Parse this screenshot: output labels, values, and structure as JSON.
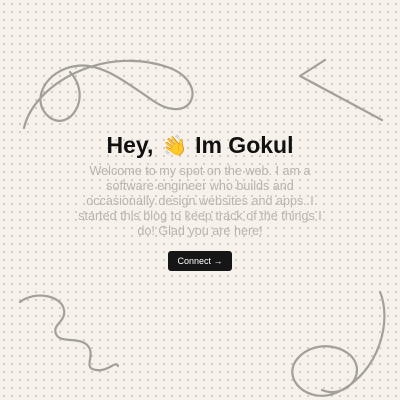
{
  "hero": {
    "greeting": "Hey,",
    "wave_emoji": "👋",
    "name": "Im Gokul",
    "intro": "Welcome to my spot on the web. I am a software engineer who builds and occasionally design websites and apps. I started this blog to keep track of the things I do! Glad you are here!",
    "connect_label": "Connect",
    "connect_icon": "→"
  },
  "colors": {
    "background": "#f6f1ea",
    "dot_grid": "#cbbfb1",
    "heading": "#111111",
    "intro_text": "#b9b4ad",
    "button_bg": "#161616",
    "button_text": "#ffffff",
    "doodle_stroke": "#a2a098"
  }
}
